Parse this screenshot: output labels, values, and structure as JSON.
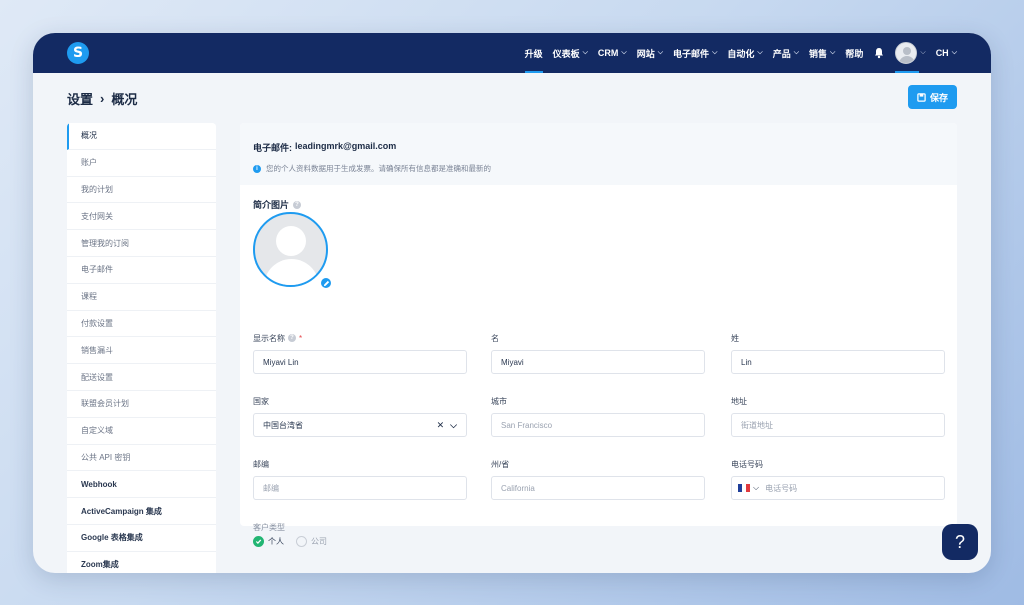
{
  "nav": {
    "logo_letter": "S",
    "items": [
      {
        "label": "升级",
        "chevron": false
      },
      {
        "label": "仪表板",
        "chevron": true
      },
      {
        "label": "CRM",
        "chevron": true
      },
      {
        "label": "网站",
        "chevron": true
      },
      {
        "label": "电子邮件",
        "chevron": true
      },
      {
        "label": "自动化",
        "chevron": true
      },
      {
        "label": "产品",
        "chevron": true
      },
      {
        "label": "销售",
        "chevron": true
      },
      {
        "label": "帮助",
        "chevron": false
      }
    ],
    "language": "CH"
  },
  "header": {
    "breadcrumb_root": "设置",
    "breadcrumb_sep": "›",
    "breadcrumb_current": "概况",
    "save_label": "保存"
  },
  "sidebar": {
    "items": [
      {
        "label": "概况",
        "active": true,
        "dark": false
      },
      {
        "label": "账户",
        "active": false,
        "dark": false
      },
      {
        "label": "我的计划",
        "active": false,
        "dark": false
      },
      {
        "label": "支付网关",
        "active": false,
        "dark": false
      },
      {
        "label": "管理我的订阅",
        "active": false,
        "dark": false
      },
      {
        "label": "电子邮件",
        "active": false,
        "dark": false
      },
      {
        "label": "课程",
        "active": false,
        "dark": false
      },
      {
        "label": "付款设置",
        "active": false,
        "dark": false
      },
      {
        "label": "销售漏斗",
        "active": false,
        "dark": false
      },
      {
        "label": "配送设置",
        "active": false,
        "dark": false
      },
      {
        "label": "联盟会员计划",
        "active": false,
        "dark": false
      },
      {
        "label": "自定义域",
        "active": false,
        "dark": false
      },
      {
        "label": "公共 API 密钥",
        "active": false,
        "dark": false
      },
      {
        "label": "Webhook",
        "active": false,
        "dark": true
      },
      {
        "label": "ActiveCampaign 集成",
        "active": false,
        "dark": true
      },
      {
        "label": "Google 表格集成",
        "active": false,
        "dark": true
      },
      {
        "label": "Zoom集成",
        "active": false,
        "dark": true
      }
    ]
  },
  "profile": {
    "email_label": "电子邮件:",
    "email_value": "leadingmrk@gmail.com",
    "note": "您的个人资料数据用于生成发票。请确保所有信息都是准确和最新的",
    "picture_label": "简介图片",
    "fields": {
      "display_name": {
        "label": "显示名称",
        "value": "Miyavi Lin",
        "required_mark": "*"
      },
      "first_name": {
        "label": "名",
        "value": "Miyavi"
      },
      "last_name": {
        "label": "姓",
        "value": "Lin"
      },
      "country": {
        "label": "国家",
        "value": "中国台湾省"
      },
      "city": {
        "label": "城市",
        "placeholder": "San Francisco"
      },
      "address": {
        "label": "地址",
        "placeholder": "街道地址"
      },
      "zip": {
        "label": "邮编",
        "placeholder": "邮编"
      },
      "state": {
        "label": "州/省",
        "placeholder": "California"
      },
      "phone": {
        "label": "电话号码",
        "placeholder": "电话号码"
      }
    },
    "customer_type": {
      "label": "客户类型",
      "options": [
        {
          "label": "个人",
          "selected": true
        },
        {
          "label": "公司",
          "selected": false
        }
      ]
    }
  },
  "help_label": "?",
  "colors": {
    "nav_bg": "#132a63",
    "accent": "#1e9bf0",
    "success": "#22b573"
  }
}
